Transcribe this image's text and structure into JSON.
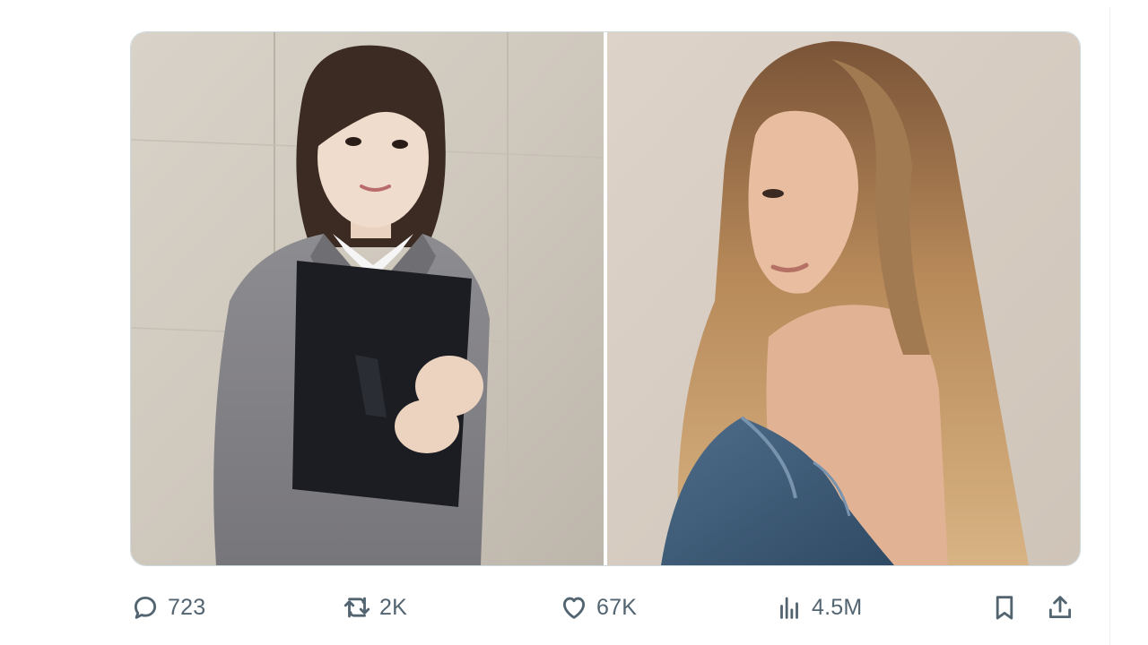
{
  "tweet": {
    "media": [
      {
        "alt_name": "photo-left"
      },
      {
        "alt_name": "photo-right"
      }
    ],
    "actions": {
      "reply": {
        "icon": "reply-icon",
        "count": "723"
      },
      "retweet": {
        "icon": "retweet-icon",
        "count": "2K"
      },
      "like": {
        "icon": "heart-icon",
        "count": "67K"
      },
      "views": {
        "icon": "analytics-icon",
        "count": "4.5M"
      },
      "bookmark": {
        "icon": "bookmark-icon"
      },
      "share": {
        "icon": "share-icon"
      }
    }
  },
  "colors": {
    "icon_gray": "#536471",
    "border": "#cfd9de",
    "divider": "#eff3f4"
  }
}
